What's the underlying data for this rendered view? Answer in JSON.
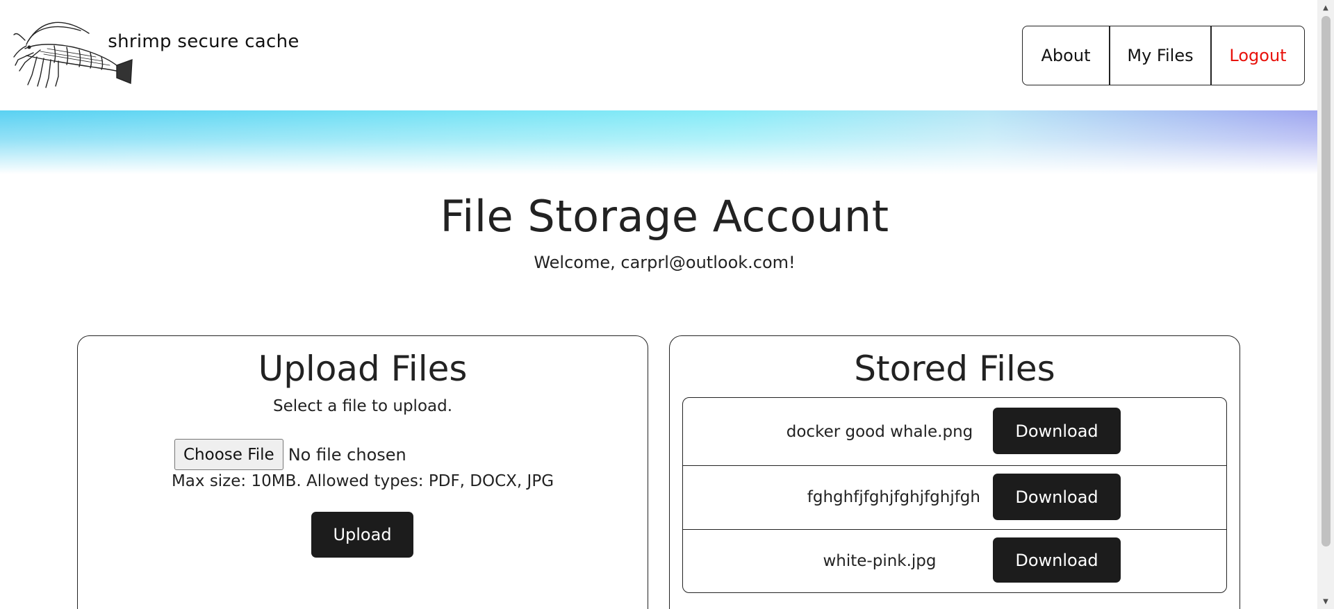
{
  "header": {
    "logo_text": "shrimp secure cache",
    "logo_icon": "shrimp-icon",
    "nav": {
      "about": "About",
      "my_files": "My Files",
      "logout": "Logout"
    },
    "logout_color": "#e8120c"
  },
  "main": {
    "title": "File Storage Account",
    "welcome": "Welcome, carprl@outlook.com!"
  },
  "upload": {
    "title": "Upload Files",
    "hint": "Select a file to upload.",
    "choose_label": "Choose File",
    "no_file": "No file chosen",
    "limits": "Max size: 10MB. Allowed types: PDF, DOCX, JPG",
    "button": "Upload"
  },
  "stored": {
    "title": "Stored Files",
    "files": [
      {
        "name": "docker good whale.png",
        "action": "Download"
      },
      {
        "name": "fghghfjfghjfghjfghjfgh",
        "action": "Download"
      },
      {
        "name": "white-pink.jpg",
        "action": "Download"
      }
    ]
  },
  "colors": {
    "button_bg": "#1c1c1c",
    "banner_start": "#5ad1f2",
    "banner_end": "#9fa6f0"
  }
}
